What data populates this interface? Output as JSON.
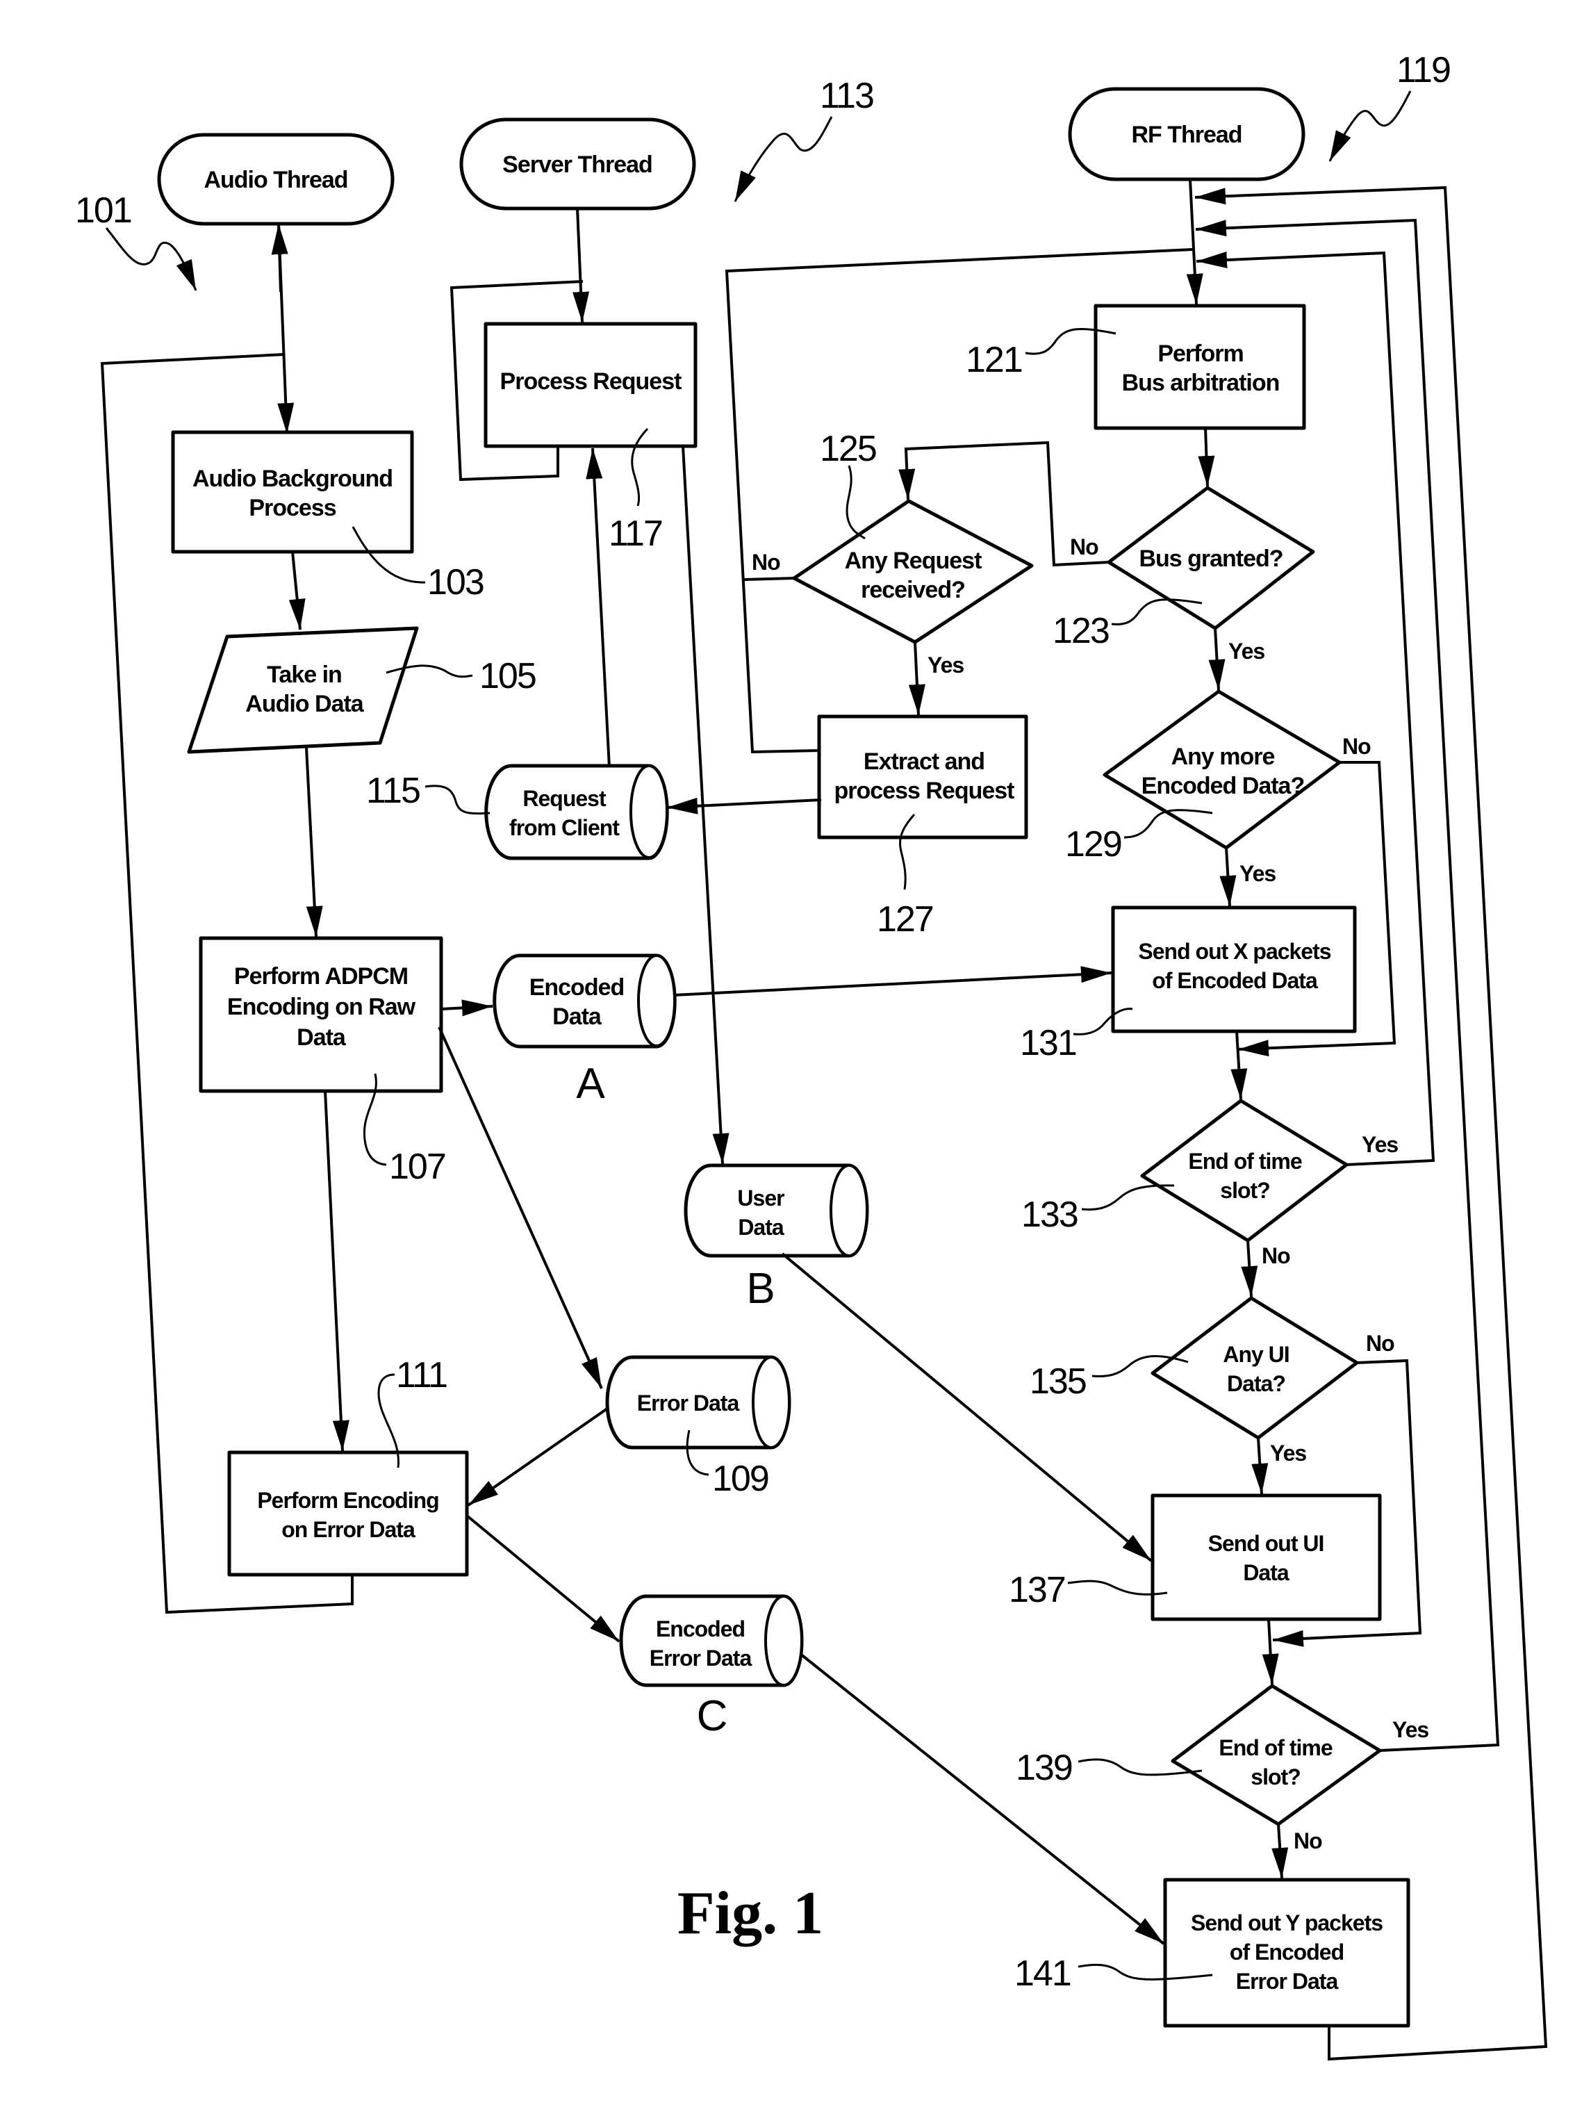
{
  "figure": {
    "caption": "Fig. 1",
    "threads": {
      "audio": {
        "ref": "101",
        "title": "Audio Thread"
      },
      "server": {
        "ref": "113",
        "title": "Server Thread"
      },
      "rf": {
        "ref": "119",
        "title": "RF Thread"
      }
    },
    "nodes": {
      "n103": {
        "ref": "103",
        "lines": [
          "Audio Background",
          "Process"
        ]
      },
      "n105": {
        "ref": "105",
        "lines": [
          "Take in",
          "Audio Data"
        ]
      },
      "n107": {
        "ref": "107",
        "lines": [
          "Perform ADPCM",
          "Encoding on Raw",
          "Data"
        ]
      },
      "n109": {
        "ref": "109",
        "lines": [
          "Error Data"
        ]
      },
      "n111": {
        "ref": "111",
        "lines": [
          "Perform Encoding",
          "on Error Data"
        ]
      },
      "n115": {
        "ref": "115",
        "lines": [
          "Request",
          "from Client"
        ]
      },
      "n117": {
        "ref": "117",
        "lines": [
          "Process Request"
        ]
      },
      "n121": {
        "ref": "121",
        "lines": [
          "Perform",
          "Bus arbitration"
        ]
      },
      "n123": {
        "ref": "123",
        "lines": [
          "Bus granted?"
        ]
      },
      "n125": {
        "ref": "125",
        "lines": [
          "Any Request",
          "received?"
        ]
      },
      "n127": {
        "ref": "127",
        "lines": [
          "Extract  and",
          "process Request"
        ]
      },
      "n129": {
        "ref": "129",
        "lines": [
          "Any more",
          "Encoded Data?"
        ]
      },
      "n131": {
        "ref": "131",
        "lines": [
          "Send out X packets",
          "of Encoded Data"
        ]
      },
      "n133": {
        "ref": "133",
        "lines": [
          "End of time",
          "slot?"
        ]
      },
      "n135": {
        "ref": "135",
        "lines": [
          "Any UI",
          "Data?"
        ]
      },
      "n137": {
        "ref": "137",
        "lines": [
          "Send out UI",
          "Data"
        ]
      },
      "n139": {
        "ref": "139",
        "lines": [
          "End of time",
          "slot?"
        ]
      },
      "n141": {
        "ref": "141",
        "lines": [
          "Send out Y packets",
          "of Encoded",
          "Error Data"
        ]
      },
      "encoded_data": {
        "lines": [
          "Encoded",
          "Data"
        ],
        "connector": "A"
      },
      "user_data": {
        "lines": [
          "User",
          "Data"
        ],
        "connector": "B"
      },
      "encoded_error_data": {
        "lines": [
          "Encoded",
          "Error Data"
        ],
        "connector": "C"
      }
    },
    "branches": {
      "yes": "Yes",
      "no": "No"
    }
  }
}
